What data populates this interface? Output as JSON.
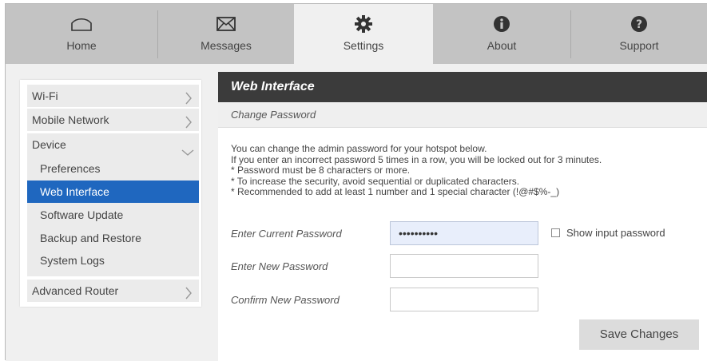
{
  "nav": {
    "tabs": [
      {
        "label": "Home",
        "icon": "home-icon",
        "active": false
      },
      {
        "label": "Messages",
        "icon": "envelope-icon",
        "active": false
      },
      {
        "label": "Settings",
        "icon": "gear-icon",
        "active": true
      },
      {
        "label": "About",
        "icon": "info-icon",
        "active": false
      },
      {
        "label": "Support",
        "icon": "question-icon",
        "active": false
      }
    ]
  },
  "sidebar": {
    "wifi": "Wi-Fi",
    "mobile_network": "Mobile Network",
    "device": "Device",
    "device_items": [
      "Preferences",
      "Web Interface",
      "Software Update",
      "Backup and Restore",
      "System Logs"
    ],
    "active_item": "Web Interface",
    "advanced_router": "Advanced Router"
  },
  "panel": {
    "title": "Web Interface",
    "subtitle": "Change Password",
    "info_lines": [
      "You can change the admin password for your hotspot below.",
      "If you enter an incorrect password 5 times in a row, you will be locked out for 3 minutes.",
      "* Password must be 8 characters or more.",
      "* To increase the security, avoid sequential or duplicated characters.",
      "* Recommended to add at least 1 number and 1 special character (!@#$%-_)"
    ],
    "current_password_label": "Enter Current Password",
    "current_password_value": "••••••••••",
    "new_password_label": "Enter New Password",
    "new_password_value": "",
    "confirm_password_label": "Confirm New Password",
    "confirm_password_value": "",
    "show_password_label": "Show input password",
    "save_label": "Save Changes"
  },
  "colors": {
    "nav_bg": "#c3c3c3",
    "active_tab_bg": "#f0f0f0",
    "title_bar": "#3b3b3b",
    "active_sidebar": "#1f67bf"
  }
}
